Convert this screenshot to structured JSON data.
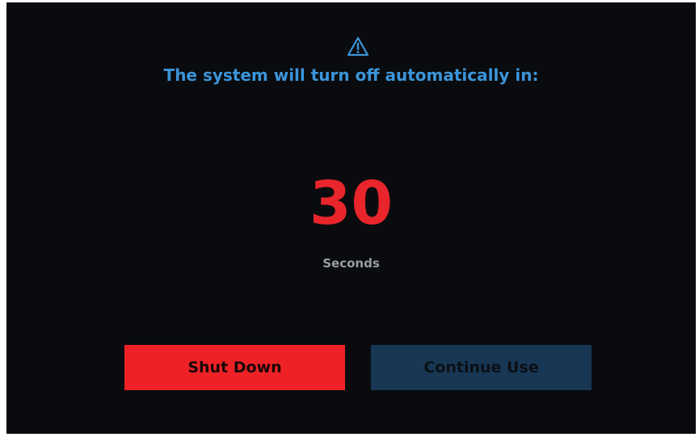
{
  "dialog": {
    "icon": "warning-triangle-icon",
    "title": "The system will turn off automatically in:",
    "countdown_value": "30",
    "countdown_unit": "Seconds"
  },
  "buttons": {
    "shutdown_label": "Shut Down",
    "continue_label": "Continue Use"
  },
  "colors": {
    "background": "#0a0b0e",
    "title": "#3b95d9",
    "countdown": "#e8252b",
    "unit": "#9a9da1",
    "shutdown_button": "#ee2226",
    "continue_button": "#173754"
  }
}
